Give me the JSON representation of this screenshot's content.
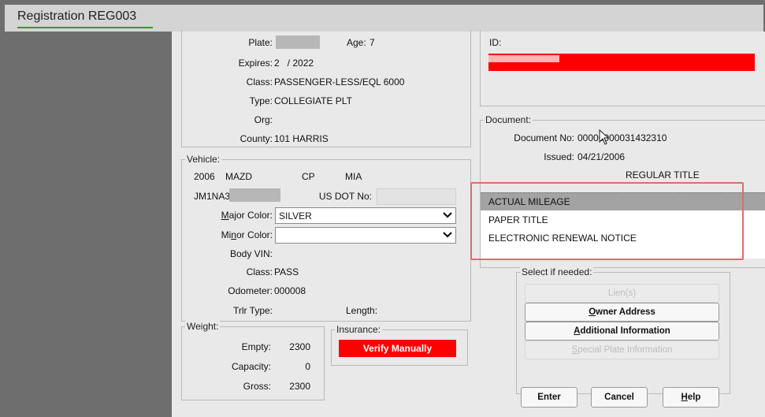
{
  "window": {
    "title": "Registration REG003"
  },
  "plate": {
    "plate_label": "Plate:",
    "age_label": "Age:",
    "age_value": "7",
    "expires_label": "Expires:",
    "expires_value": "2   / 2022",
    "class_label": "Class:",
    "class_value": "PASSENGER-LESS/EQL 6000",
    "type_label": "Type:",
    "type_value": "COLLEGIATE PLT",
    "org_label": "Org:",
    "county_label": "County:",
    "county_value": "101 HARRIS"
  },
  "vehicle": {
    "group_label": "Vehicle:",
    "year": "2006",
    "make": "MAZD",
    "body": "CP",
    "code": "MIA",
    "vin_prefix": "JM1NA35",
    "usdot_label": "US DOT No:",
    "major_color_pre": "M",
    "major_color_rest": "ajor Color:",
    "major_color_value": "SILVER",
    "minor_color_pre": "Mi",
    "minor_color_u": "n",
    "minor_color_rest": "or Color:",
    "minor_color_value": "",
    "body_vin_label": "Body VIN:",
    "class_label": "Class:",
    "class_value": "PASS",
    "odometer_label": "Odometer:",
    "odometer_value": "000008",
    "trlr_label": "Trlr Type:",
    "length_label": "Length:"
  },
  "weight": {
    "group_label": "Weight:",
    "empty_label": "Empty:",
    "empty_value": "2300",
    "capacity_label": "Capacity:",
    "capacity_value": "0",
    "gross_label": "Gross:",
    "gross_value": "2300"
  },
  "insurance": {
    "group_label": "Insurance:",
    "status": "Verify Manually"
  },
  "id_section": {
    "id_label": "ID:"
  },
  "document": {
    "group_label": "Document:",
    "doc_no_label": "Document No:",
    "doc_no_value": "00000000031432310",
    "issued_label": "Issued:",
    "issued_value": "04/21/2006",
    "title_type": "REGULAR TITLE",
    "items": [
      "ACTUAL MILEAGE",
      "PAPER TITLE",
      "ELECTRONIC RENEWAL NOTICE"
    ]
  },
  "select_panel": {
    "group_label": "Select if needed:",
    "liens_label": "Lien(s)",
    "owner_u": "O",
    "owner_rest": "wner Address",
    "addl_u": "A",
    "addl_rest": "dditional Information",
    "special_u": "S",
    "special_rest": "pecial Plate Information"
  },
  "actions": {
    "enter_label": "Enter",
    "cancel_label": "Cancel",
    "help_u": "H",
    "help_rest": "elp"
  },
  "colors": {
    "accent_green": "#2f9a2f",
    "alert_red": "#ff0000",
    "highlight_box": "#e06b6b",
    "selected_row": "#a3a3a3"
  }
}
